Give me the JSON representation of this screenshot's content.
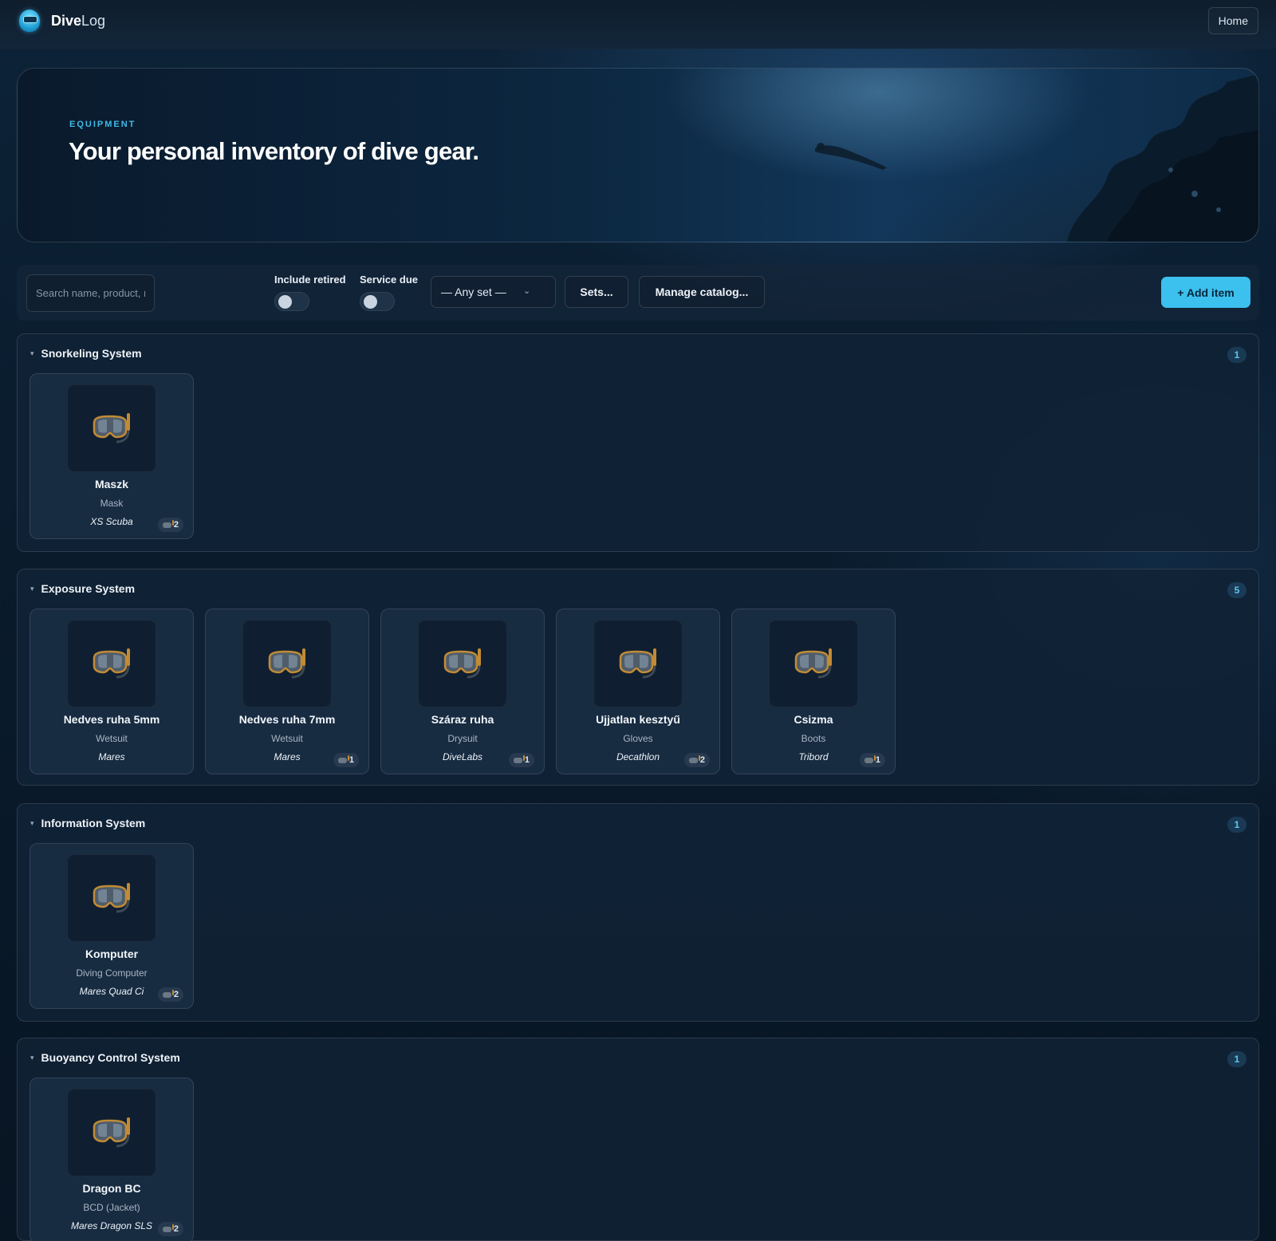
{
  "app": {
    "name_bold": "Dive",
    "name_light": "Log",
    "nav_home": "Home"
  },
  "hero": {
    "eyebrow": "EQUIPMENT",
    "title": "Your personal inventory of dive gear."
  },
  "filters": {
    "search_placeholder": "Search name, product, r",
    "include_retired": "Include retired",
    "service_due": "Service due",
    "set_select": "— Any set —",
    "sets_button": "Sets...",
    "manage_button": "Manage catalog...",
    "add_button": "+ Add item"
  },
  "sections": [
    {
      "title": "Snorkeling System",
      "count": "1",
      "items": [
        {
          "name": "Maszk",
          "type": "Mask",
          "brand": "XS Scuba",
          "uses": "2"
        }
      ]
    },
    {
      "title": "Exposure System",
      "count": "5",
      "items": [
        {
          "name": "Nedves ruha 5mm",
          "type": "Wetsuit",
          "brand": "Mares",
          "uses": ""
        },
        {
          "name": "Nedves ruha 7mm",
          "type": "Wetsuit",
          "brand": "Mares",
          "uses": "1"
        },
        {
          "name": "Száraz ruha",
          "type": "Drysuit",
          "brand": "DiveLabs",
          "uses": "1"
        },
        {
          "name": "Ujjatlan kesztyű",
          "type": "Gloves",
          "brand": "Decathlon",
          "uses": "2"
        },
        {
          "name": "Csizma",
          "type": "Boots",
          "brand": "Tribord",
          "uses": "1"
        }
      ]
    },
    {
      "title": "Information System",
      "count": "1",
      "items": [
        {
          "name": "Komputer",
          "type": "Diving Computer",
          "brand": "Mares Quad Ci",
          "uses": "2"
        }
      ]
    },
    {
      "title": "Buoyancy Control System",
      "count": "1",
      "items": [
        {
          "name": "Dragon BC",
          "type": "BCD (Jacket)",
          "brand": "Mares Dragon SLS",
          "uses": "2"
        }
      ]
    }
  ],
  "icons": {
    "item_thumbnail": "snorkel-mask-icon",
    "usage_badge": "snorkel-mask-icon",
    "section_toggle": "caret-down-icon",
    "select_arrow": "chevron-down-icon"
  },
  "colors": {
    "accent": "#3cc0ee",
    "background": "#0a1c2e",
    "eyebrow": "#3fb9e6"
  }
}
